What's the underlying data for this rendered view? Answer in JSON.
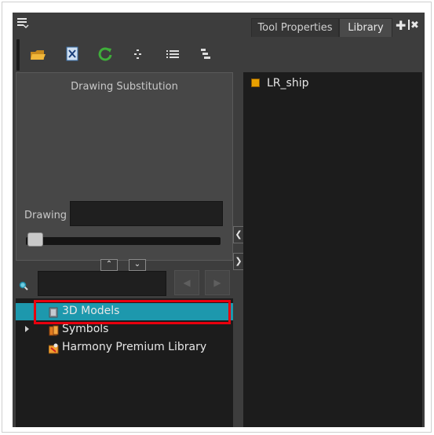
{
  "tabs": [
    {
      "label": "Tool Properties",
      "active": false
    },
    {
      "label": "Library",
      "active": true
    }
  ],
  "icons": {
    "menu": "hamburger-menu-icon",
    "add_panel": "plus-icon",
    "close_panel": "close-icon"
  },
  "toolbar": [
    "folder-open-icon",
    "delete-icon",
    "refresh-icon",
    "tree-view-icon",
    "list-view-icon",
    "details-view-icon"
  ],
  "substitution": {
    "title": "Drawing Substitution",
    "drawing_label": "Drawing",
    "drawing_value": "",
    "slider_level": 0
  },
  "search": {
    "value": ""
  },
  "tree": {
    "items": [
      {
        "label": "3D Models",
        "selected": true,
        "icon": "3d-models-folder-icon"
      },
      {
        "label": "Symbols",
        "selected": false,
        "icon": "symbols-folder-icon",
        "expandable": true
      },
      {
        "label": "Harmony Premium Library",
        "selected": false,
        "icon": "library-folder-icon"
      }
    ]
  },
  "content": {
    "items": [
      {
        "label": "LR_ship",
        "icon": "symbol-icon"
      }
    ]
  },
  "colors": {
    "panel_bg": "#3d3d3d",
    "selection": "#1d98ad",
    "highlight_box": "#e8000e"
  }
}
